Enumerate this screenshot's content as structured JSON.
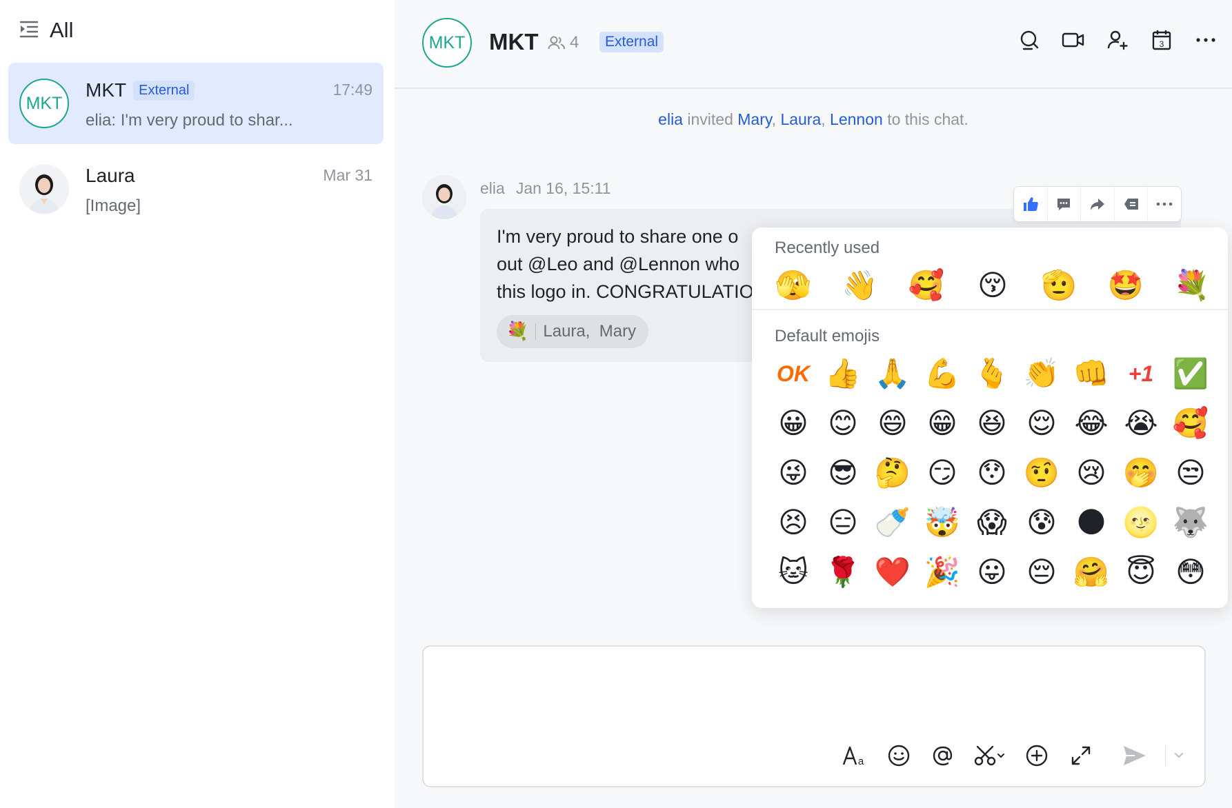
{
  "sidebar": {
    "title": "All",
    "conversations": [
      {
        "avatar_text": "MKT",
        "name": "MKT",
        "badge": "External",
        "time": "17:49",
        "preview": "elia: I'm very proud to shar...",
        "active": true
      },
      {
        "name": "Laura",
        "time": "Mar 31",
        "preview": "[Image]",
        "active": false
      }
    ]
  },
  "chat": {
    "avatar_text": "MKT",
    "name": "MKT",
    "member_count": "4",
    "badge": "External",
    "toolbar_icons": [
      "search-icon",
      "video-call-icon",
      "add-member-icon",
      "calendar-icon",
      "more-icon"
    ],
    "calendar_day": "3"
  },
  "system_message": {
    "actor": "elia",
    "verb": "invited",
    "users": [
      "Mary",
      "Laura",
      "Lennon"
    ],
    "comma": ",",
    "suffix": "to this chat."
  },
  "message": {
    "sender": "elia",
    "timestamp": "Jan 16, 15:11",
    "lines": [
      "I'm very proud to share one o",
      "out @Leo and @Lennon who",
      "this logo in. CONGRATULATIO"
    ],
    "reaction": {
      "emoji": "💐",
      "users": "Laura,  Mary"
    },
    "actions": [
      "thumbs-up-icon",
      "reply-icon",
      "forward-icon",
      "quote-icon",
      "more-icon"
    ]
  },
  "emoji_picker": {
    "recent_title": "Recently used",
    "recent": [
      "🫣",
      "👋",
      "🥰",
      "😚",
      "🫡",
      "🤩",
      "💐"
    ],
    "default_title": "Default emojis",
    "default": [
      "OK",
      "👍",
      "🙏",
      "💪",
      "🫰",
      "👏",
      "👊",
      "+1",
      "✅",
      "😀",
      "😊",
      "😄",
      "😁",
      "😆",
      "😌",
      "😂",
      "😭",
      "🥰",
      "😜",
      "😎",
      "🤔",
      "😏",
      "😯",
      "🤨",
      "😢",
      "🤭",
      "😒",
      "😣",
      "😑",
      "🍼",
      "🤯",
      "😱",
      "😰",
      "🌑",
      "🌝",
      "🐺",
      "🐱",
      "🌹",
      "❤️",
      "🎉",
      "😛",
      "😔",
      "🤗",
      "😇",
      "😳"
    ]
  },
  "composer": {
    "tools": [
      "format-icon",
      "emoji-icon",
      "mention-icon",
      "screenshot-icon",
      "add-icon",
      "expand-icon",
      "send-icon",
      "send-options-icon"
    ]
  },
  "colors": {
    "accent": "#245bdb",
    "active_bg": "#e1eaff",
    "avatar_green": "#1ea68f",
    "external_badge_bg": "#d4e2ff"
  }
}
